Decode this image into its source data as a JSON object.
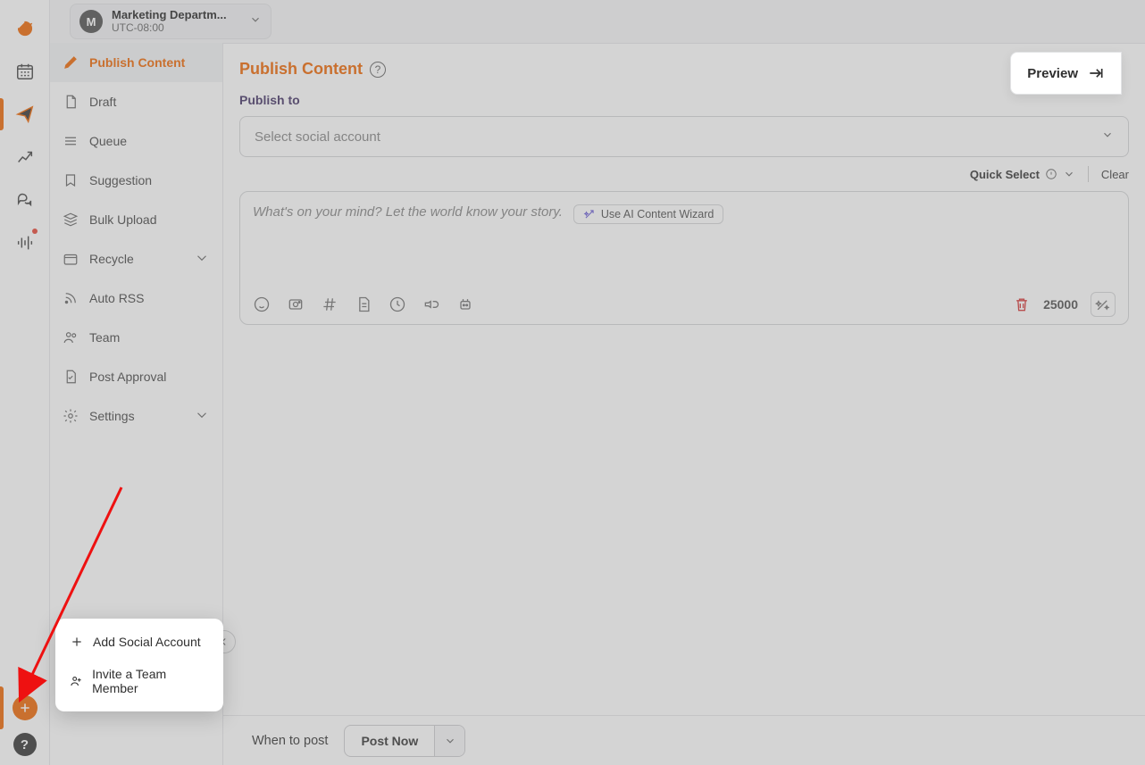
{
  "workspace": {
    "avatar_initial": "M",
    "name": "Marketing Departm...",
    "timezone": "UTC-08:00"
  },
  "subnav": {
    "items": [
      {
        "label": "Publish Content"
      },
      {
        "label": "Draft"
      },
      {
        "label": "Queue"
      },
      {
        "label": "Suggestion"
      },
      {
        "label": "Bulk Upload"
      },
      {
        "label": "Recycle"
      },
      {
        "label": "Auto RSS"
      },
      {
        "label": "Team"
      },
      {
        "label": "Post Approval"
      },
      {
        "label": "Settings"
      }
    ]
  },
  "main": {
    "title": "Publish Content",
    "publish_to_label": "Publish to",
    "account_placeholder": "Select social account",
    "quick_select_label": "Quick Select",
    "clear_label": "Clear",
    "composer_placeholder": "What's on your mind? Let the world know your story.",
    "ai_chip_label": "Use AI Content Wizard",
    "char_count": "25000",
    "preview_label": "Preview"
  },
  "schedule": {
    "label": "When to post",
    "value": "Post Now"
  },
  "popup": {
    "add_account": "Add Social Account",
    "invite_member": "Invite a Team Member"
  },
  "help_glyph": "?"
}
